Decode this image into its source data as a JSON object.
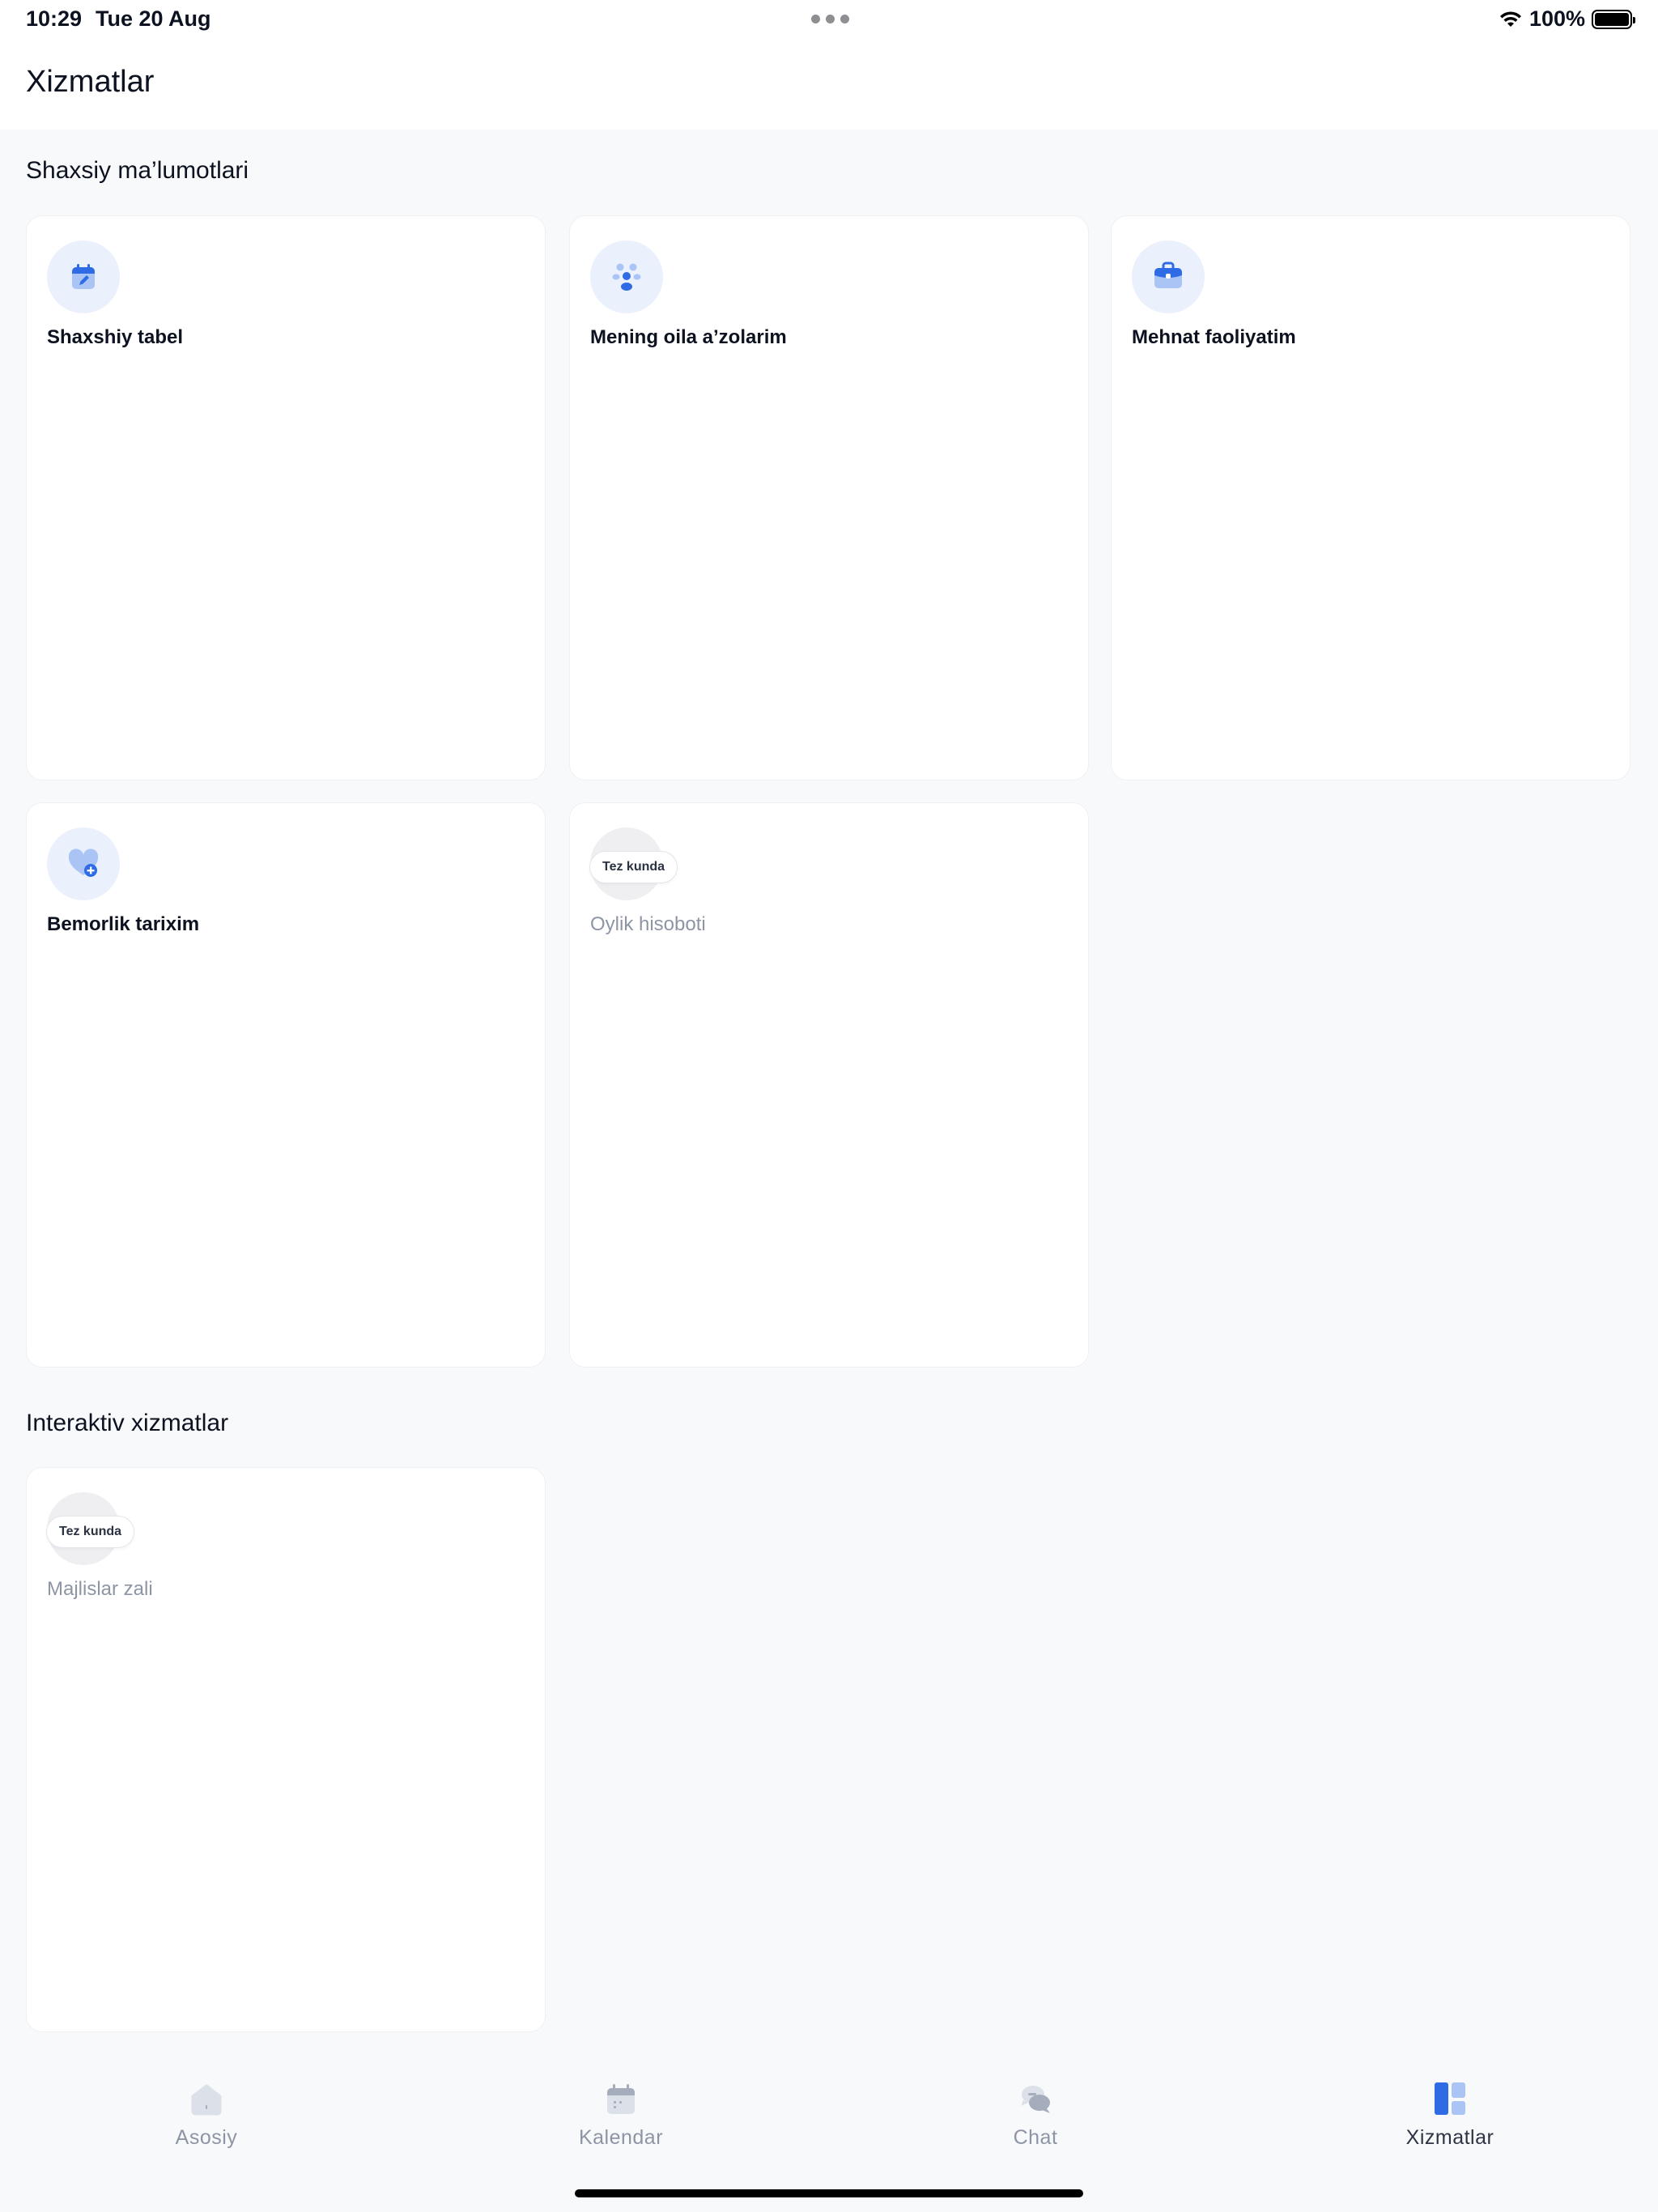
{
  "status_bar": {
    "time": "10:29",
    "date": "Tue 20 Aug",
    "battery": "100%"
  },
  "header": {
    "title": "Xizmatlar"
  },
  "sections": [
    {
      "title": "Shaxsiy ma’lumotlari",
      "cards": [
        {
          "label": "Shaxshiy tabel",
          "icon": "calendar-edit-icon"
        },
        {
          "label": "Mening oila a’zolarim",
          "icon": "family-icon"
        },
        {
          "label": "Mehnat faoliyatim",
          "icon": "briefcase-icon"
        },
        {
          "label": "Bemorlik tarixim",
          "icon": "heart-plus-icon"
        },
        {
          "label": "Oylik hisoboti",
          "badge": "Tez kunda",
          "disabled": true
        }
      ]
    },
    {
      "title": "Interaktiv xizmatlar",
      "cards": [
        {
          "label": "Majlislar zali",
          "badge": "Tez kunda",
          "disabled": true
        }
      ]
    }
  ],
  "tabbar": {
    "tabs": [
      {
        "label": "Asosiy",
        "icon": "home-icon"
      },
      {
        "label": "Kalendar",
        "icon": "calendar-icon"
      },
      {
        "label": "Chat",
        "icon": "chat-icon"
      },
      {
        "label": "Xizmatlar",
        "icon": "services-grid-icon",
        "active": true
      }
    ]
  },
  "colors": {
    "accent": "#2F6BE4",
    "accent_light": "#A9C4F5",
    "icon_bg": "#EAF0FC",
    "text_primary": "#0D1220",
    "text_muted": "#8D95A5",
    "background": "#F8F9FB"
  }
}
